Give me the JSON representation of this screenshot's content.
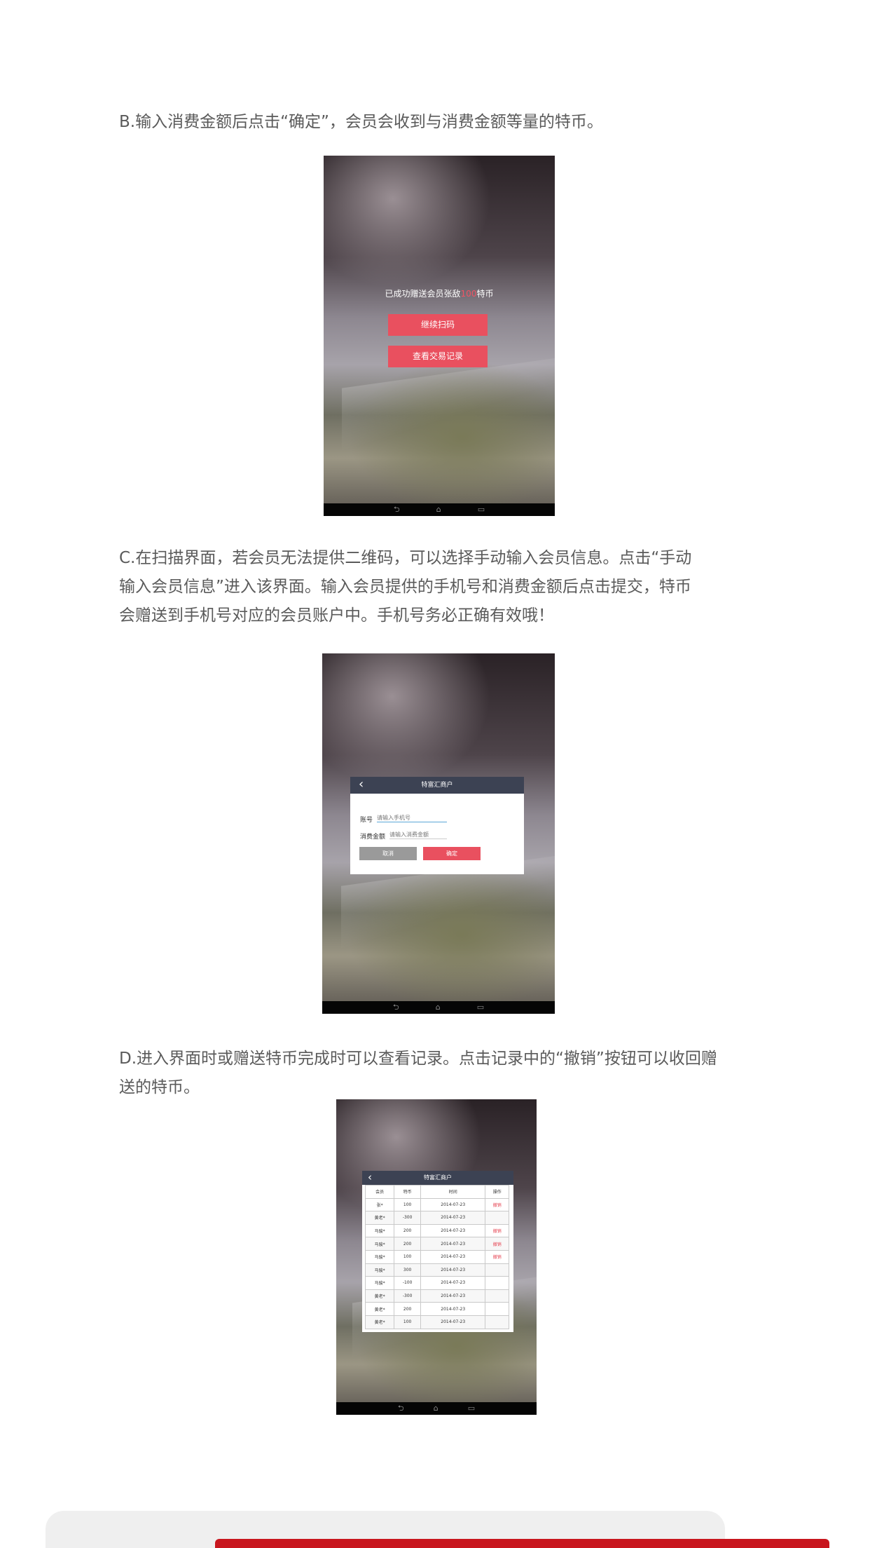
{
  "paragraphs": {
    "b": "B.输入消费金额后点击“确定”，会员会收到与消费金额等量的特币。",
    "c_line1": "C.在扫描界面，若会员无法提供二维码，可以选择手动输入会员信息。点击“手动",
    "c_line2": "输入会员信息”进入该界面。输入会员提供的手机号和消费金额后点击提交，特币",
    "c_line3": "会赠送到手机号对应的会员账户中。手机号务必正确有效哦！",
    "d_line1": "D.进入界面时或赠送特币完成时可以查看记录。点击记录中的“撤销”按钮可以收回赠",
    "d_line2": "送的特币。"
  },
  "nav_icons": [
    "back-icon",
    "home-icon",
    "recents-icon"
  ],
  "nav_glyphs": [
    "⮌",
    "⌂",
    "▭"
  ],
  "screen1": {
    "message_prefix": "已成功赠送会员张敌",
    "message_amount": "100",
    "message_suffix": "特币",
    "continue_scan": "继续扫码",
    "view_records": "查看交易记录"
  },
  "screen2": {
    "title": "特富汇商户",
    "back_glyph": "‹",
    "account_label": "账号",
    "account_placeholder": "请输入手机号",
    "amount_label": "消费金额",
    "amount_placeholder": "请输入消费金额",
    "cancel": "取消",
    "confirm": "确定"
  },
  "screen3": {
    "title": "特富汇商户",
    "back_glyph": "‹",
    "headers": [
      "会员",
      "特币",
      "时间",
      "操作"
    ],
    "rows": [
      [
        "张*",
        "100",
        "2014-07-23",
        "撤销"
      ],
      [
        "黄老*",
        "-300",
        "2014-07-23",
        ""
      ],
      [
        "马骏*",
        "200",
        "2014-07-23",
        "撤销"
      ],
      [
        "马骏*",
        "200",
        "2014-07-23",
        "撤销"
      ],
      [
        "马骏*",
        "100",
        "2014-07-23",
        "撤销"
      ],
      [
        "马骏*",
        "300",
        "2014-07-23",
        ""
      ],
      [
        "马骏*",
        "-100",
        "2014-07-23",
        ""
      ],
      [
        "黄老*",
        "-300",
        "2014-07-23",
        ""
      ],
      [
        "黄老*",
        "200",
        "2014-07-23",
        ""
      ],
      [
        "黄老*",
        "100",
        "2014-07-23",
        ""
      ]
    ]
  },
  "colors": {
    "accent": "#e9505f",
    "dialog_header": "#3c4253",
    "brand_red": "#c8161e",
    "cancel_grey": "#9a9a9a"
  }
}
